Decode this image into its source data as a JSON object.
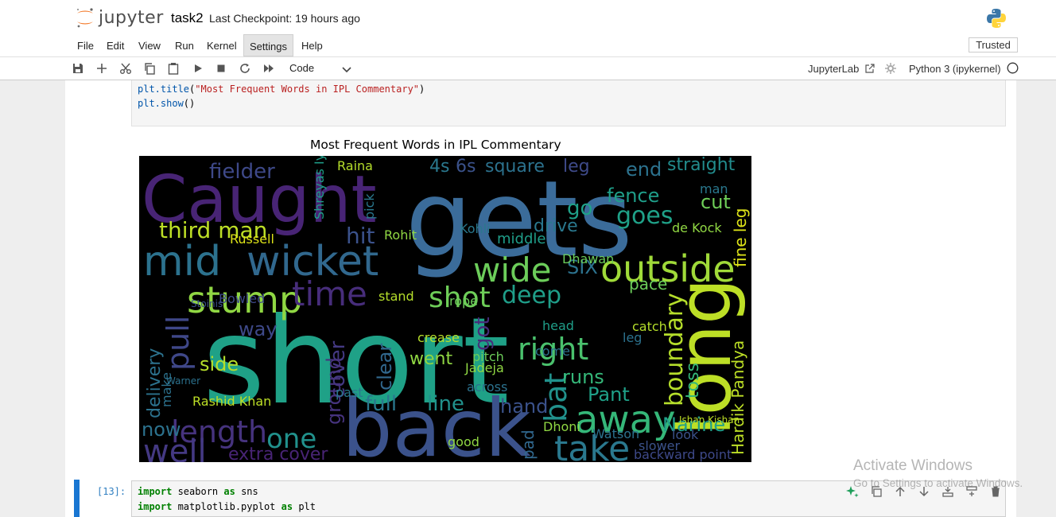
{
  "header": {
    "logo_text": "jupyter",
    "notebook_name": "task2",
    "checkpoint": "Last Checkpoint: 19 hours ago",
    "trusted": "Trusted"
  },
  "menu": {
    "items": [
      "File",
      "Edit",
      "View",
      "Run",
      "Kernel",
      "Settings",
      "Help"
    ],
    "active": "Settings"
  },
  "toolbar": {
    "cell_type": "Code",
    "jupyterlab_link": "JupyterLab",
    "kernel_name": "Python 3 (ipykernel)",
    "icons": [
      "save-icon",
      "add-icon",
      "cut-icon",
      "copy-icon",
      "paste-icon",
      "run-icon",
      "stop-icon",
      "restart-icon",
      "fast-forward-icon"
    ]
  },
  "cell1": {
    "code_lines": [
      "plt.title(\"Most Frequent Words in IPL Commentary\")",
      "plt.show()"
    ]
  },
  "output": {
    "title": "Most Frequent Words in IPL Commentary",
    "words": [
      {
        "t": "short",
        "c": "#1fa187"
      },
      {
        "t": "gets",
        "c": "#3b6c9a"
      },
      {
        "t": "back",
        "c": "#3b528b"
      },
      {
        "t": "Caught",
        "c": "#482475"
      },
      {
        "t": "long",
        "c": "#bddf26"
      },
      {
        "t": "outside",
        "c": "#a0da39"
      },
      {
        "t": "wide",
        "c": "#6ccd5a"
      },
      {
        "t": "mid",
        "c": "#2c728e"
      },
      {
        "t": "wicket",
        "c": "#31688e"
      },
      {
        "t": "stump",
        "c": "#90d743"
      },
      {
        "t": "time",
        "c": "#472d7b"
      },
      {
        "t": "away",
        "c": "#35b779"
      },
      {
        "t": "take",
        "c": "#2a788e"
      },
      {
        "t": "right",
        "c": "#4ac16d"
      },
      {
        "t": "length",
        "c": "#46337e"
      },
      {
        "t": "well",
        "c": "#443983"
      },
      {
        "t": "one",
        "c": "#21918c"
      },
      {
        "t": "pull",
        "c": "#3f4889"
      },
      {
        "t": "shot",
        "c": "#6ece58"
      },
      {
        "t": "deep",
        "c": "#1f9e89"
      },
      {
        "t": "third man",
        "c": "#bddf26"
      },
      {
        "t": "fielder",
        "c": "#3e4989"
      },
      {
        "t": "goes",
        "c": "#1fa188"
      },
      {
        "t": "bat",
        "c": "#21918c"
      },
      {
        "t": "went",
        "c": "#90d743"
      },
      {
        "t": "boundary",
        "c": "#b5de2b"
      },
      {
        "t": "Hardik Pandya",
        "c": "#bddf26"
      },
      {
        "t": "fine leg",
        "c": "#dde318"
      },
      {
        "t": "straight",
        "c": "#228c8d"
      },
      {
        "t": "square",
        "c": "#2c728e"
      },
      {
        "t": "leg",
        "c": "#3e4a89"
      },
      {
        "t": "4s",
        "c": "#2a788e"
      },
      {
        "t": "6s",
        "c": "#3b528b"
      },
      {
        "t": "end",
        "c": "#2c728e"
      },
      {
        "t": "fence",
        "c": "#1f9e89"
      },
      {
        "t": "cut",
        "c": "#6ece58"
      },
      {
        "t": "drive",
        "c": "#2a788e"
      },
      {
        "t": "hit",
        "c": "#3b528b"
      },
      {
        "t": "go",
        "c": "#1fa188"
      },
      {
        "t": "SIX",
        "c": "#2c728e"
      },
      {
        "t": "pace",
        "c": "#6ccd5a"
      },
      {
        "t": "runs",
        "c": "#35b779"
      },
      {
        "t": "Pant",
        "c": "#1fa188"
      },
      {
        "t": "line",
        "c": "#21918c"
      },
      {
        "t": "full",
        "c": "#2a788e"
      },
      {
        "t": "hand",
        "c": "#3b528b"
      },
      {
        "t": "Narine",
        "c": "#1f9e89"
      },
      {
        "t": "now",
        "c": "#2c728e"
      },
      {
        "t": "side",
        "c": "#b5de2b"
      },
      {
        "t": "way",
        "c": "#3e4989"
      },
      {
        "t": "clear",
        "c": "#31688e"
      },
      {
        "t": "cover",
        "c": "#443983"
      },
      {
        "t": "got",
        "c": "#472d7b"
      },
      {
        "t": "extra cover",
        "c": "#482475"
      },
      {
        "t": "Rashid Khan",
        "c": "#bddf26"
      },
      {
        "t": "ground",
        "c": "#46337e"
      },
      {
        "t": "delivery",
        "c": "#2c728e"
      },
      {
        "t": "toss",
        "c": "#35b779"
      },
      {
        "t": "middle",
        "c": "#1f9e89"
      },
      {
        "t": "Kohli",
        "c": "#2a788e"
      },
      {
        "t": "Russell",
        "c": "#dde318"
      },
      {
        "t": "Dhawan",
        "c": "#6ccd5a"
      },
      {
        "t": "de Kock",
        "c": "#90d743"
      },
      {
        "t": "Watson",
        "c": "#2c728e"
      },
      {
        "t": "backward point",
        "c": "#3e4989"
      },
      {
        "t": "pad",
        "c": "#31688e"
      },
      {
        "t": "good",
        "c": "#90d743"
      },
      {
        "t": "crease",
        "c": "#b5de2b"
      },
      {
        "t": "rope",
        "c": "#6ccd5a"
      },
      {
        "t": "come",
        "c": "#2c728e"
      },
      {
        "t": "head",
        "c": "#1f9e89"
      },
      {
        "t": "catch",
        "c": "#b5de2b"
      },
      {
        "t": "look",
        "c": "#3b528b"
      },
      {
        "t": "past",
        "c": "#2a788e"
      },
      {
        "t": "across",
        "c": "#2c728e"
      },
      {
        "t": "pitch",
        "c": "#6ccd5a"
      },
      {
        "t": "Dhoni",
        "c": "#90d743"
      },
      {
        "t": "slower",
        "c": "#3b528b"
      },
      {
        "t": "Jadeja",
        "c": "#90d743"
      },
      {
        "t": "Raina",
        "c": "#b5de2b"
      },
      {
        "t": "pick",
        "c": "#2a788e"
      },
      {
        "t": "Shreyas Iyer",
        "c": "#1f9e89"
      },
      {
        "t": "Warner",
        "c": "#2c728e"
      },
      {
        "t": "Bowled",
        "c": "#3e4989"
      },
      {
        "t": "make",
        "c": "#2c728e"
      },
      {
        "t": "Stoinis",
        "c": "#3b528b"
      },
      {
        "t": "Rohit",
        "c": "#90d743"
      },
      {
        "t": "man",
        "c": "#2a788e"
      },
      {
        "t": "leg",
        "c": "#2c728e"
      },
      {
        "t": "stand",
        "c": "#b5de2b"
      },
      {
        "t": "Ishan Kishan",
        "c": "#bddf26"
      }
    ]
  },
  "cell2": {
    "prompt": "[13]:",
    "code_lines": [
      {
        "kw": "import",
        "rest": " seaborn ",
        "kw2": "as",
        "rest2": " sns"
      },
      {
        "kw": "import",
        "rest": " matplotlib.pyplot ",
        "kw2": "as",
        "rest2": " plt"
      }
    ]
  },
  "watermark": {
    "line1": "Activate Windows",
    "line2": "Go to Settings to activate Windows."
  }
}
